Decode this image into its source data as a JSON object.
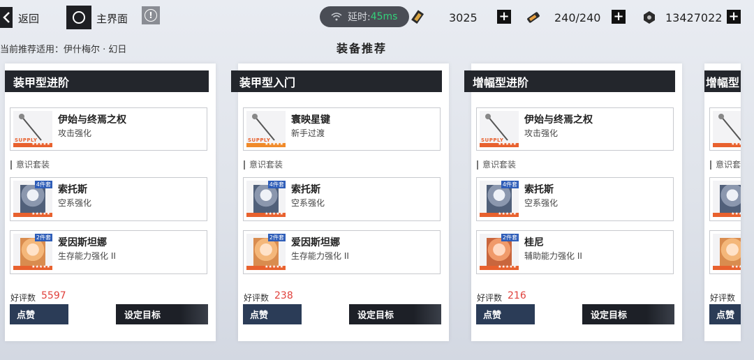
{
  "topbar": {
    "back_label": "返回",
    "home_label": "主界面",
    "latency_label": "延时:",
    "latency_value": "45ms",
    "resources": [
      {
        "icon": "gold-bar-icon",
        "value": "3025"
      },
      {
        "icon": "stamina-battery-icon",
        "value": "240/240"
      },
      {
        "icon": "coin-icon",
        "value": "13427022"
      }
    ]
  },
  "subheader": {
    "applies_to": "当前推荐适用：伊什梅尔 · 幻日",
    "page_title": "装备推荐"
  },
  "section_label": "意识套装",
  "likes_label": "好评数",
  "like_button": "点赞",
  "target_button": "设定目标",
  "cards": [
    {
      "title": "装甲型进阶",
      "weapon": {
        "name": "伊始与终焉之权",
        "desc": "攻击强化",
        "tag": "SUPPLY"
      },
      "suits": [
        {
          "name": "索托斯",
          "desc": "空系强化",
          "tag": "4件套"
        },
        {
          "name": "爱因斯坦娜",
          "desc": "生存能力强化 II",
          "tag": "2件套"
        }
      ],
      "likes": "5597"
    },
    {
      "title": "装甲型入门",
      "weapon": {
        "name": "寰映星键",
        "desc": "新手过渡",
        "tag": "SUPPLY"
      },
      "suits": [
        {
          "name": "索托斯",
          "desc": "空系强化",
          "tag": "4件套"
        },
        {
          "name": "爱因斯坦娜",
          "desc": "生存能力强化 II",
          "tag": "2件套"
        }
      ],
      "likes": "238"
    },
    {
      "title": "增幅型进阶",
      "weapon": {
        "name": "伊始与终焉之权",
        "desc": "攻击强化",
        "tag": "SUPPLY"
      },
      "suits": [
        {
          "name": "索托斯",
          "desc": "空系强化",
          "tag": "4件套"
        },
        {
          "name": "桂尼",
          "desc": "辅助能力强化 II",
          "tag": "2件套"
        }
      ],
      "likes": "216"
    },
    {
      "title": "增幅型",
      "section_label_partial": "意识套"
    }
  ],
  "colors": {
    "header_bg": "#23262c",
    "like_button_bg": "#2b3c57",
    "likes_value": "#e0413c",
    "latency_ok": "#33d17a",
    "supply_stripe": "#e8612e"
  }
}
